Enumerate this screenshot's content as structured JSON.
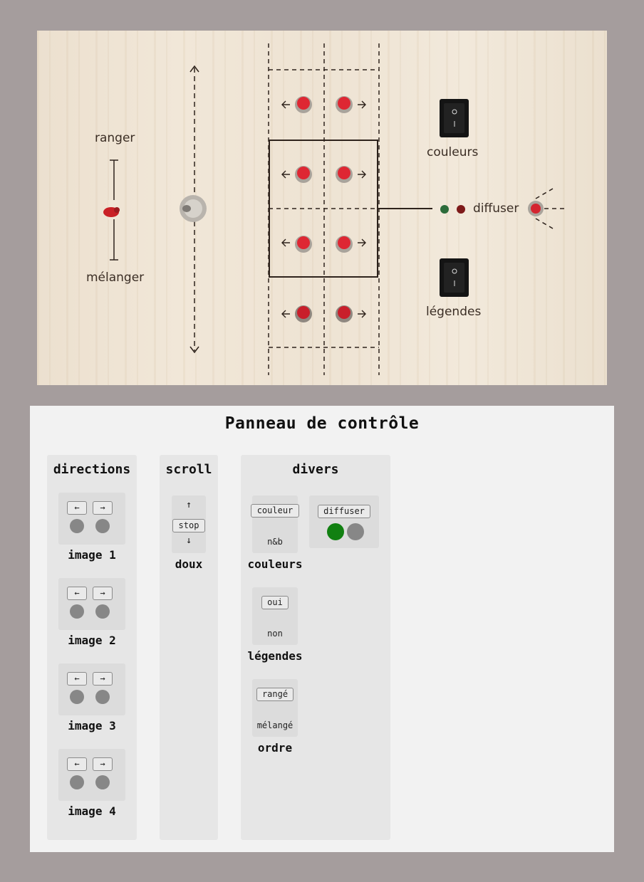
{
  "photo": {
    "labels": {
      "ranger": "ranger",
      "melanger": "mélanger",
      "couleurs": "couleurs",
      "diffuser": "diffuser",
      "legendes": "légendes"
    }
  },
  "panel": {
    "title": "Panneau de contrôle",
    "directions": {
      "title": "directions",
      "images": [
        {
          "caption": "image 1",
          "left": "←",
          "right": "→"
        },
        {
          "caption": "image 2",
          "left": "←",
          "right": "→"
        },
        {
          "caption": "image 3",
          "left": "←",
          "right": "→"
        },
        {
          "caption": "image 4",
          "left": "←",
          "right": "→"
        }
      ]
    },
    "scroll": {
      "title": "scroll",
      "up": "↑",
      "stop": "stop",
      "down": "↓",
      "caption": "doux"
    },
    "divers": {
      "title": "divers",
      "couleurs": {
        "on": "couleur",
        "off": "n&b",
        "caption": "couleurs"
      },
      "legendes": {
        "on": "oui",
        "off": "non",
        "caption": "légendes"
      },
      "ordre": {
        "on": "rangé",
        "off": "mélangé",
        "caption": "ordre"
      },
      "diffuser": {
        "label": "diffuser",
        "led_on_color": "#118011",
        "led_off_color": "#878787"
      }
    }
  }
}
